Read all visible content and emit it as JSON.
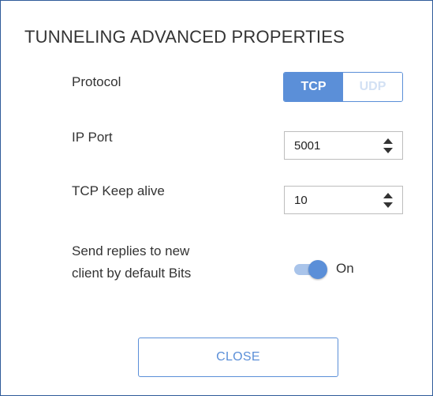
{
  "dialog": {
    "title": "TUNNELING ADVANCED PROPERTIES"
  },
  "protocol": {
    "label": "Protocol",
    "options": [
      "TCP",
      "UDP"
    ],
    "selected": "TCP"
  },
  "ip_port": {
    "label": "IP Port",
    "value": "5001"
  },
  "tcp_keep_alive": {
    "label": "TCP Keep alive",
    "value": "10"
  },
  "send_replies": {
    "label_line1": "Send replies to new",
    "label_line2": "client by default Bits",
    "toggle_state": "On"
  },
  "buttons": {
    "close_label": "CLOSE"
  },
  "colors": {
    "accent": "#5b8fd8",
    "border": "#2f5b9a",
    "inactive_text": "#d3e1f4",
    "toggle_track": "#a9c4ea"
  }
}
